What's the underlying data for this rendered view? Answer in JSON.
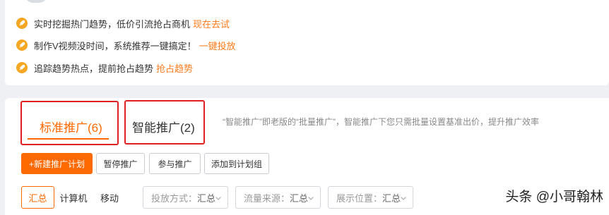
{
  "tips": [
    {
      "text": "实时挖掘热门趋势，低价引流抢占商机",
      "link": "现在去试"
    },
    {
      "text": "制作V视频没时间，系统推荐一键搞定！",
      "link": "一键投放"
    },
    {
      "text": "追踪趋势热点，提前抢占趋势",
      "link": "抢占趋势"
    }
  ],
  "tabs": {
    "standard": "标准推广(6)",
    "smart": "智能推广(2)",
    "description": "“智能推广”即老版的“批量推广”，智能推广下您只需批量设置基准出价，提升推广效率"
  },
  "actions": {
    "new_plan": "+新建推广计划",
    "pause": "暂停推广",
    "join": "参与推广",
    "add_group": "添加到计划组"
  },
  "segments": {
    "summary": "汇总",
    "computer": "计算机",
    "mobile": "移动"
  },
  "filters": [
    {
      "label": "投放方式：",
      "value": "汇总"
    },
    {
      "label": "流量来源：",
      "value": "汇总"
    },
    {
      "label": "展示位置：",
      "value": "汇总"
    }
  ],
  "watermark": "头条 @小哥翰林",
  "colors": {
    "accent": "#ff6a00",
    "highlight_box": "#e02020",
    "tip_icon": "#f5a623"
  },
  "icons": {
    "tip": "rocket-icon",
    "dropdown": "chevron-down-icon"
  }
}
